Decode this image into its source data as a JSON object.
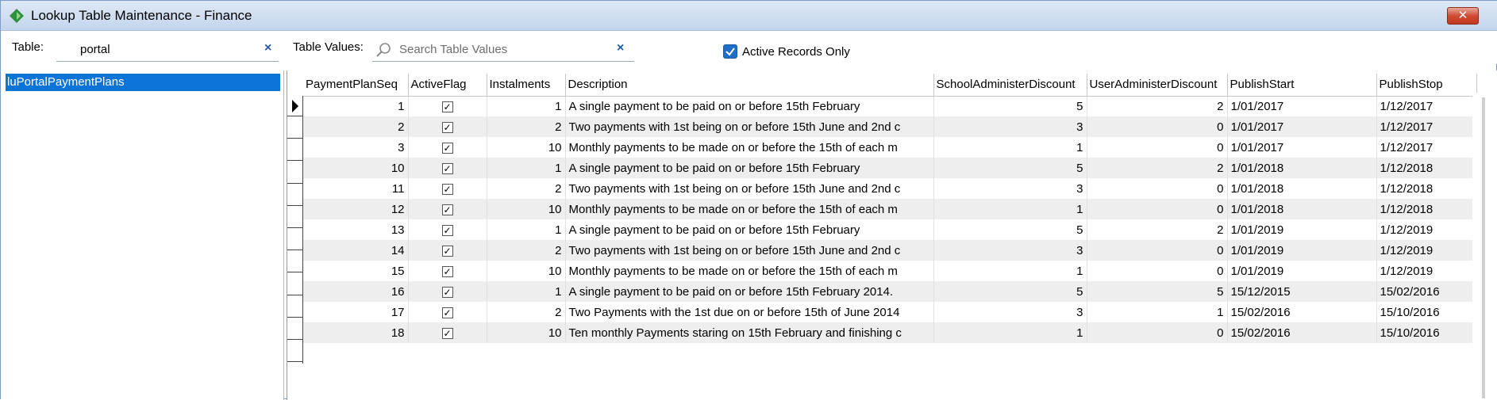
{
  "window": {
    "title": "Lookup Table Maintenance - Finance",
    "close_label": "✕"
  },
  "toolbar": {
    "table_label": "Table:",
    "table_value": "portal",
    "clear_label": "×",
    "table_values_label": "Table Values:",
    "search_placeholder": "Search Table Values",
    "active_only_label": "Active Records Only",
    "active_only_checked": true
  },
  "left_panel": {
    "items": [
      {
        "label": "luPortalPaymentPlans",
        "selected": true
      }
    ]
  },
  "grid": {
    "columns": [
      "PaymentPlanSeq",
      "ActiveFlag",
      "Instalments",
      "Description",
      "SchoolAdministerDiscount",
      "UserAdministerDiscount",
      "PublishStart",
      "PublishStop"
    ],
    "rows": [
      {
        "seq": "1",
        "active": "✓",
        "instalments": "1",
        "description": "A single payment to be paid on or before 15th February",
        "school": "5",
        "user": "2",
        "start": "1/01/2017",
        "stop": "1/12/2017"
      },
      {
        "seq": "2",
        "active": "✓",
        "instalments": "2",
        "description": "Two payments with 1st being on or before 15th June and 2nd c",
        "school": "3",
        "user": "0",
        "start": "1/01/2017",
        "stop": "1/12/2017"
      },
      {
        "seq": "3",
        "active": "✓",
        "instalments": "10",
        "description": "Monthly payments to be made on or before the 15th of each m",
        "school": "1",
        "user": "0",
        "start": "1/01/2017",
        "stop": "1/12/2017"
      },
      {
        "seq": "10",
        "active": "✓",
        "instalments": "1",
        "description": "A single payment to be paid on or before 15th February",
        "school": "5",
        "user": "2",
        "start": "1/01/2018",
        "stop": "1/12/2018"
      },
      {
        "seq": "11",
        "active": "✓",
        "instalments": "2",
        "description": "Two payments with 1st being on or before 15th June and 2nd c",
        "school": "3",
        "user": "0",
        "start": "1/01/2018",
        "stop": "1/12/2018"
      },
      {
        "seq": "12",
        "active": "✓",
        "instalments": "10",
        "description": "Monthly payments to be made on or before the 15th of each m",
        "school": "1",
        "user": "0",
        "start": "1/01/2018",
        "stop": "1/12/2018"
      },
      {
        "seq": "13",
        "active": "✓",
        "instalments": "1",
        "description": "A single payment to be paid on or before 15th February",
        "school": "5",
        "user": "2",
        "start": "1/01/2019",
        "stop": "1/12/2019"
      },
      {
        "seq": "14",
        "active": "✓",
        "instalments": "2",
        "description": "Two payments with 1st being on or before 15th June and 2nd c",
        "school": "3",
        "user": "0",
        "start": "1/01/2019",
        "stop": "1/12/2019"
      },
      {
        "seq": "15",
        "active": "✓",
        "instalments": "10",
        "description": "Monthly payments to be made on or before the 15th of each m",
        "school": "1",
        "user": "0",
        "start": "1/01/2019",
        "stop": "1/12/2019"
      },
      {
        "seq": "16",
        "active": "✓",
        "instalments": "1",
        "description": "A single payment to be paid on or before 15th February 2014.",
        "school": "5",
        "user": "5",
        "start": "15/12/2015",
        "stop": "15/02/2016"
      },
      {
        "seq": "17",
        "active": "✓",
        "instalments": "2",
        "description": "Two Payments with the 1st due on or before 15th of June 2014",
        "school": "3",
        "user": "1",
        "start": "15/02/2016",
        "stop": "15/10/2016"
      },
      {
        "seq": "18",
        "active": "✓",
        "instalments": "10",
        "description": "Ten monthly Payments staring on 15th February and finishing c",
        "school": "1",
        "user": "0",
        "start": "15/02/2016",
        "stop": "15/10/2016"
      }
    ]
  }
}
